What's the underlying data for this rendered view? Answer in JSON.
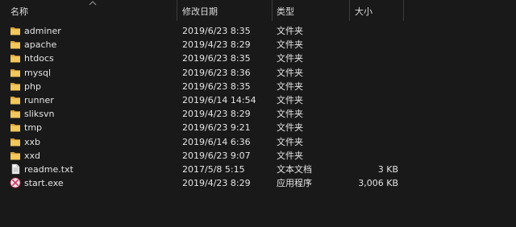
{
  "columns": {
    "name": "名称",
    "modified": "修改日期",
    "type": "类型",
    "size": "大小"
  },
  "sort": {
    "column": "name",
    "direction": "ascending"
  },
  "files": [
    {
      "name": "adminer",
      "modified": "2019/6/23 8:35",
      "type": "文件夹",
      "size": "",
      "icon": "folder-icon"
    },
    {
      "name": "apache",
      "modified": "2019/4/23 8:29",
      "type": "文件夹",
      "size": "",
      "icon": "folder-icon"
    },
    {
      "name": "htdocs",
      "modified": "2019/6/23 8:35",
      "type": "文件夹",
      "size": "",
      "icon": "folder-icon"
    },
    {
      "name": "mysql",
      "modified": "2019/6/23 8:36",
      "type": "文件夹",
      "size": "",
      "icon": "folder-icon"
    },
    {
      "name": "php",
      "modified": "2019/6/23 8:35",
      "type": "文件夹",
      "size": "",
      "icon": "folder-icon"
    },
    {
      "name": "runner",
      "modified": "2019/6/14 14:54",
      "type": "文件夹",
      "size": "",
      "icon": "folder-icon"
    },
    {
      "name": "sliksvn",
      "modified": "2019/4/23 8:29",
      "type": "文件夹",
      "size": "",
      "icon": "folder-icon"
    },
    {
      "name": "tmp",
      "modified": "2019/6/23 9:21",
      "type": "文件夹",
      "size": "",
      "icon": "folder-icon"
    },
    {
      "name": "xxb",
      "modified": "2019/6/14 6:36",
      "type": "文件夹",
      "size": "",
      "icon": "folder-icon"
    },
    {
      "name": "xxd",
      "modified": "2019/6/23 9:07",
      "type": "文件夹",
      "size": "",
      "icon": "folder-icon"
    },
    {
      "name": "readme.txt",
      "modified": "2017/5/8 5:15",
      "type": "文本文档",
      "size": "3 KB",
      "icon": "text-file-icon"
    },
    {
      "name": "start.exe",
      "modified": "2019/4/23 8:29",
      "type": "应用程序",
      "size": "3,006 KB",
      "icon": "app-exe-icon"
    }
  ],
  "colors": {
    "background": "#191919",
    "text": "#e4e4e4",
    "folder": "#e8b64a",
    "separator": "#3a3a3a"
  }
}
